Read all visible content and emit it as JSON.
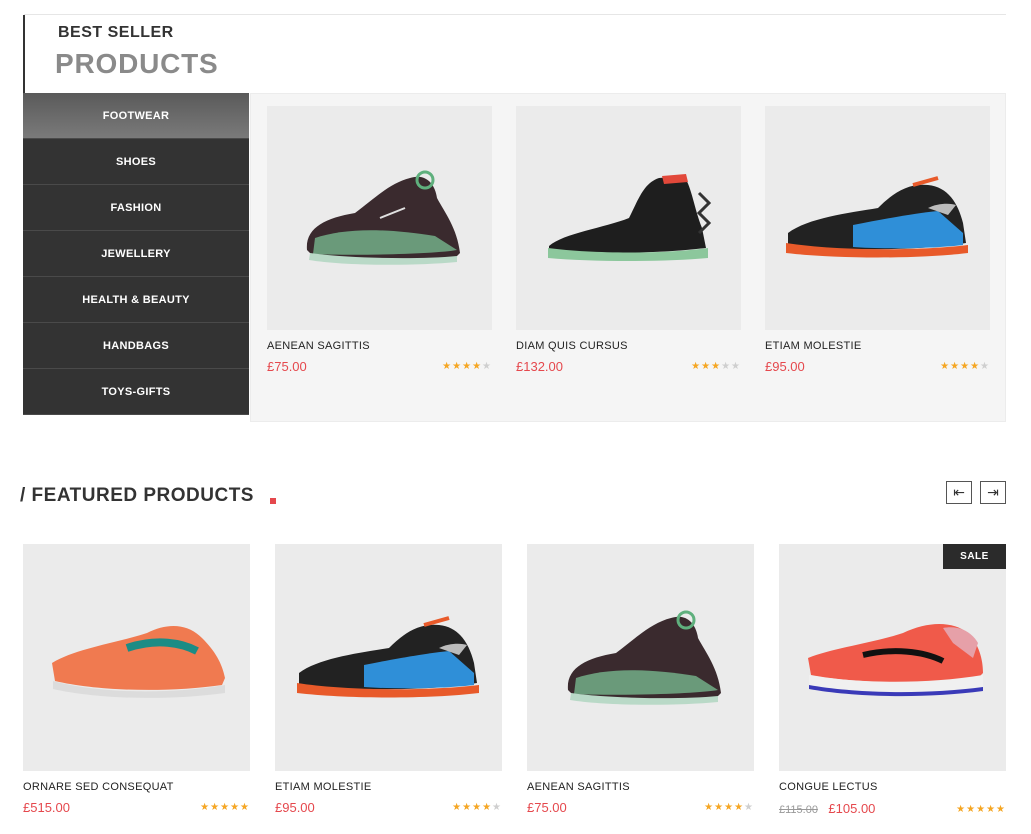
{
  "header": {
    "small_title": "BEST SELLER",
    "big_title": "PRODUCTS"
  },
  "categories": [
    {
      "label": "FOOTWEAR",
      "active": true
    },
    {
      "label": "SHOES"
    },
    {
      "label": "FASHION"
    },
    {
      "label": "JEWELLERY"
    },
    {
      "label": "HEALTH & BEAUTY"
    },
    {
      "label": "HANDBAGS"
    },
    {
      "label": "TOYS-GIFTS"
    }
  ],
  "best_sellers": [
    {
      "name": "AENEAN SAGITTIS",
      "price": "£75.00",
      "rating": 4,
      "image": "basketball-sneaker-green-icon"
    },
    {
      "name": "DIAM QUIS CURSUS",
      "price": "£132.00",
      "rating": 3,
      "image": "black-hightop-sneaker-icon"
    },
    {
      "name": "ETIAM MOLESTIE",
      "price": "£95.00",
      "rating": 4,
      "image": "blue-orange-sneaker-icon"
    }
  ],
  "featured": {
    "title": "/ FEATURED PRODUCTS",
    "prev_icon": "arrow-left-icon",
    "next_icon": "arrow-right-icon",
    "products": [
      {
        "name": "ORNARE SED CONSEQUAT",
        "price": "£515.00",
        "rating": 5,
        "image": "orange-running-shoe-icon"
      },
      {
        "name": "ETIAM MOLESTIE",
        "price": "£95.00",
        "rating": 4,
        "image": "blue-orange-sneaker-icon"
      },
      {
        "name": "AENEAN SAGITTIS",
        "price": "£75.00",
        "rating": 4,
        "image": "basketball-sneaker-green-icon"
      },
      {
        "name": "CONGUE LECTUS",
        "old_price": "£115.00",
        "price": "£105.00",
        "rating": 5,
        "badge": "SALE",
        "image": "red-running-shoe-icon"
      }
    ]
  },
  "colors": {
    "accent": "#e5484d",
    "star": "#f5a623",
    "menu_bg": "#333333"
  }
}
